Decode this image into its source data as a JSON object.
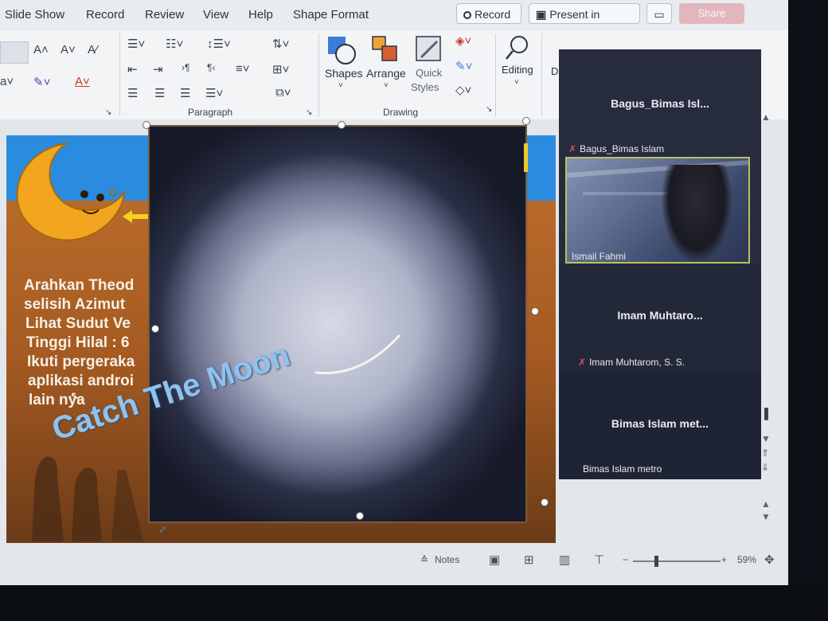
{
  "menu": {
    "items": [
      "Slide Show",
      "Record",
      "Review",
      "View",
      "Help",
      "Shape Format"
    ],
    "record_button": "Record",
    "present_in_teams": "Present in Teams",
    "share": "Share"
  },
  "ribbon": {
    "groups": {
      "paragraph": "Paragraph",
      "drawing": "Drawing"
    },
    "buttons": {
      "shapes": "Shapes",
      "arrange": "Arrange",
      "quick": "Quick",
      "styles": "Styles",
      "editing": "Editing",
      "designer_partial": "D"
    }
  },
  "slide": {
    "lines": [
      "Arahkan Theod",
      "selisih Azimut",
      "Lihat Sudut Ve",
      "Tinggi Hilal : 6",
      "Ikuti pergeraka",
      "aplikasi androi",
      "lain nya"
    ],
    "wordart": "Catch The Moon"
  },
  "teams": {
    "participants": [
      {
        "tile_title": "Bagus_Bimas Isl...",
        "label": "Bagus_Bimas Islam",
        "muted": true
      },
      {
        "tile_title": "",
        "label": "Ismail Fahmi",
        "muted": false,
        "video": true
      },
      {
        "tile_title": "Imam Muhtaro...",
        "label": "Imam Muhtarom, S. S.",
        "muted": true
      },
      {
        "tile_title": "Bimas Islam met...",
        "label": "Bimas Islam metro",
        "muted": false
      }
    ]
  },
  "statusbar": {
    "notes": "Notes",
    "zoom": "59%"
  },
  "colors": {
    "accent": "#2b8cdf",
    "teams_panel": "#262b3d",
    "wordart": "#8fc2ee",
    "muted_mic": "#e0524d"
  }
}
